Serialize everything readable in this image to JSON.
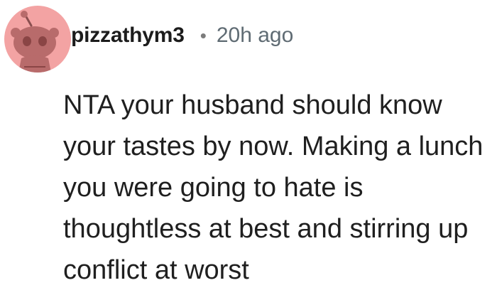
{
  "comment": {
    "avatar_icon": "reddit-snoo-avatar-icon",
    "avatar_color": "#f3a3a3",
    "username": "pizzathym3",
    "separator": "•",
    "timestamp": "20h ago",
    "body": "NTA your husband should know your tastes by now. Making a lunch you were going to hate is thoughtless at best and stirring up conflict at worst"
  }
}
